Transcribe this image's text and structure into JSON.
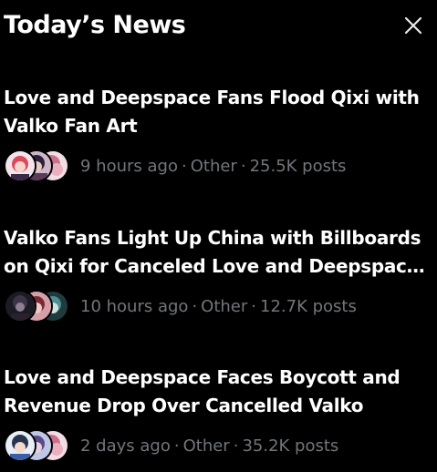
{
  "header": {
    "title": "Today’s News"
  },
  "news": [
    {
      "headline_line1": "Love and Deepspace Fans Flood Qixi with",
      "headline_line2": "Valko Fan Art",
      "time": "9 hours ago",
      "category": "Other",
      "posts": "25.5K posts",
      "separator": "·"
    },
    {
      "headline_line1": "Valko Fans Light Up China with Billboards",
      "headline_line2": "on Qixi for Canceled Love and Deepspace ...",
      "time": "10 hours ago",
      "category": "Other",
      "posts": "12.7K posts",
      "separator": "·"
    },
    {
      "headline_line1": "Love and Deepspace Faces Boycott and",
      "headline_line2": "Revenue Drop Over Cancelled Valko",
      "time": "2 days ago",
      "category": "Other",
      "posts": "35.2K posts",
      "separator": "·"
    }
  ],
  "colors": {
    "background": "#000000",
    "headline": "#ffffff",
    "meta": "#71767b"
  },
  "icons": {
    "close": "close-icon"
  }
}
